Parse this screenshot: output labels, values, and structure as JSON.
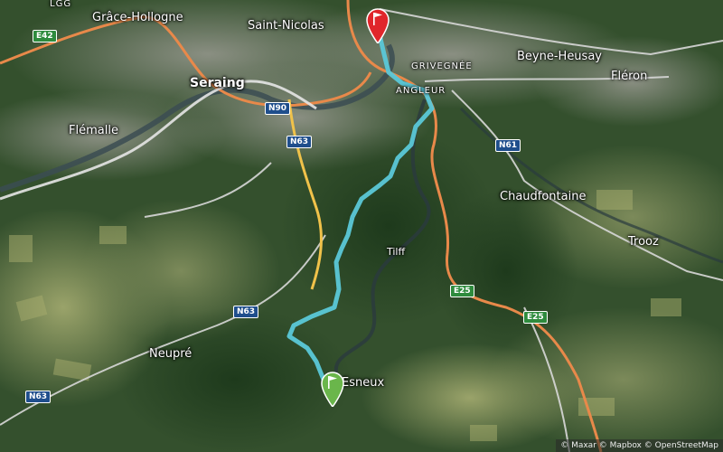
{
  "map": {
    "places": [
      {
        "id": "lgg",
        "label": "LGG"
      },
      {
        "id": "grace-hollogne",
        "label": "Grâce-Hollogne"
      },
      {
        "id": "saint-nicolas",
        "label": "Saint-Nicolas"
      },
      {
        "id": "grivegnee",
        "label": "GRIVEGNÉE"
      },
      {
        "id": "beyne-heusay",
        "label": "Beyne-Heusay"
      },
      {
        "id": "fleron",
        "label": "Fléron"
      },
      {
        "id": "seraing",
        "label": "Seraing"
      },
      {
        "id": "angleur",
        "label": "ANGLEUR"
      },
      {
        "id": "flemalle",
        "label": "Flémalle"
      },
      {
        "id": "chaudfontaine",
        "label": "Chaudfontaine"
      },
      {
        "id": "tilff",
        "label": "Tilff"
      },
      {
        "id": "trooz",
        "label": "Trooz"
      },
      {
        "id": "neupre",
        "label": "Neupré"
      },
      {
        "id": "esneux",
        "label": "Esneux"
      }
    ],
    "road_shields": [
      {
        "id": "e42",
        "label": "E42",
        "type": "euro"
      },
      {
        "id": "n90",
        "label": "N90",
        "type": "national"
      },
      {
        "id": "n63a",
        "label": "N63",
        "type": "national"
      },
      {
        "id": "n61",
        "label": "N61",
        "type": "national"
      },
      {
        "id": "e25a",
        "label": "E25",
        "type": "euro"
      },
      {
        "id": "e25b",
        "label": "E25",
        "type": "euro"
      },
      {
        "id": "n63b",
        "label": "N63",
        "type": "national"
      },
      {
        "id": "n63c",
        "label": "N63",
        "type": "national"
      }
    ],
    "route": {
      "color": "#5bc8d8",
      "start_marker": {
        "color": "#6ab64b",
        "icon": "flag-icon"
      },
      "end_marker": {
        "color": "#e0262b",
        "icon": "flag-icon"
      }
    },
    "colors": {
      "motorway": "#e8894a",
      "primary": "#f0c24a",
      "secondary": "#d8d8d8",
      "river": "#3b4c52"
    },
    "attribution": "© Maxar © Mapbox © OpenStreetMap"
  }
}
